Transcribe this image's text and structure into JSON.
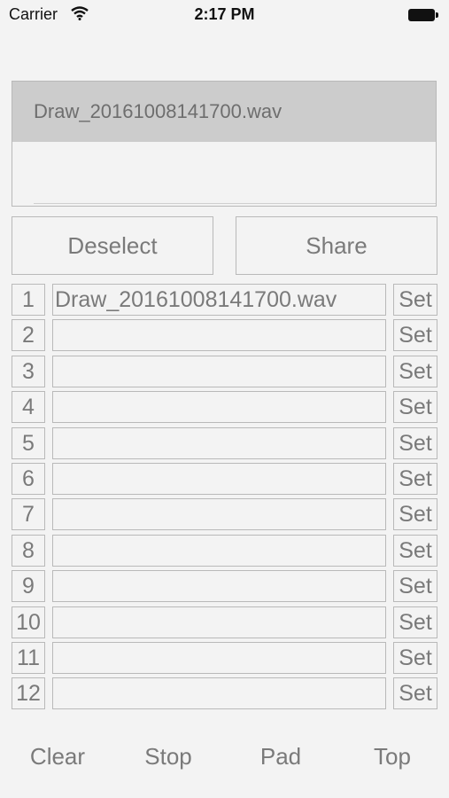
{
  "status_bar": {
    "carrier": "Carrier",
    "time": "2:17 PM"
  },
  "file_list": {
    "items": [
      "Draw_20161008141700.wav"
    ]
  },
  "actions": {
    "deselect": "Deselect",
    "share": "Share"
  },
  "slots": [
    {
      "number": "1",
      "file": "Draw_20161008141700.wav",
      "set_label": "Set"
    },
    {
      "number": "2",
      "file": "",
      "set_label": "Set"
    },
    {
      "number": "3",
      "file": "",
      "set_label": "Set"
    },
    {
      "number": "4",
      "file": "",
      "set_label": "Set"
    },
    {
      "number": "5",
      "file": "",
      "set_label": "Set"
    },
    {
      "number": "6",
      "file": "",
      "set_label": "Set"
    },
    {
      "number": "7",
      "file": "",
      "set_label": "Set"
    },
    {
      "number": "8",
      "file": "",
      "set_label": "Set"
    },
    {
      "number": "9",
      "file": "",
      "set_label": "Set"
    },
    {
      "number": "10",
      "file": "",
      "set_label": "Set"
    },
    {
      "number": "11",
      "file": "",
      "set_label": "Set"
    },
    {
      "number": "12",
      "file": "",
      "set_label": "Set"
    }
  ],
  "toolbar": {
    "clear": "Clear",
    "stop": "Stop",
    "pad": "Pad",
    "top": "Top"
  }
}
